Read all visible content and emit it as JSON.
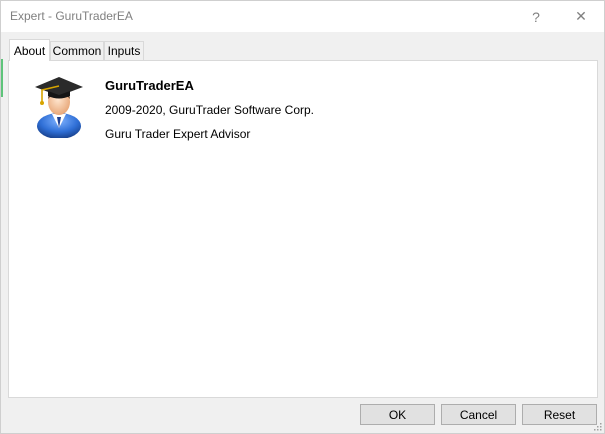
{
  "window": {
    "title": "Expert - GuruTraderEA",
    "help_glyph": "?",
    "close_glyph": "✕"
  },
  "tabs": [
    {
      "label": "About",
      "active": true
    },
    {
      "label": "Common",
      "active": false
    },
    {
      "label": "Inputs",
      "active": false
    }
  ],
  "about": {
    "name": "GuruTraderEA",
    "copyright": "2009-2020, GuruTrader Software Corp.",
    "description": "Guru Trader Expert Advisor",
    "icon": "graduate-advisor-icon"
  },
  "buttons": {
    "ok": "OK",
    "cancel": "Cancel",
    "reset": "Reset"
  },
  "colors": {
    "accent_green": "#5ec47a",
    "icon_blue": "#2f6fd6"
  }
}
